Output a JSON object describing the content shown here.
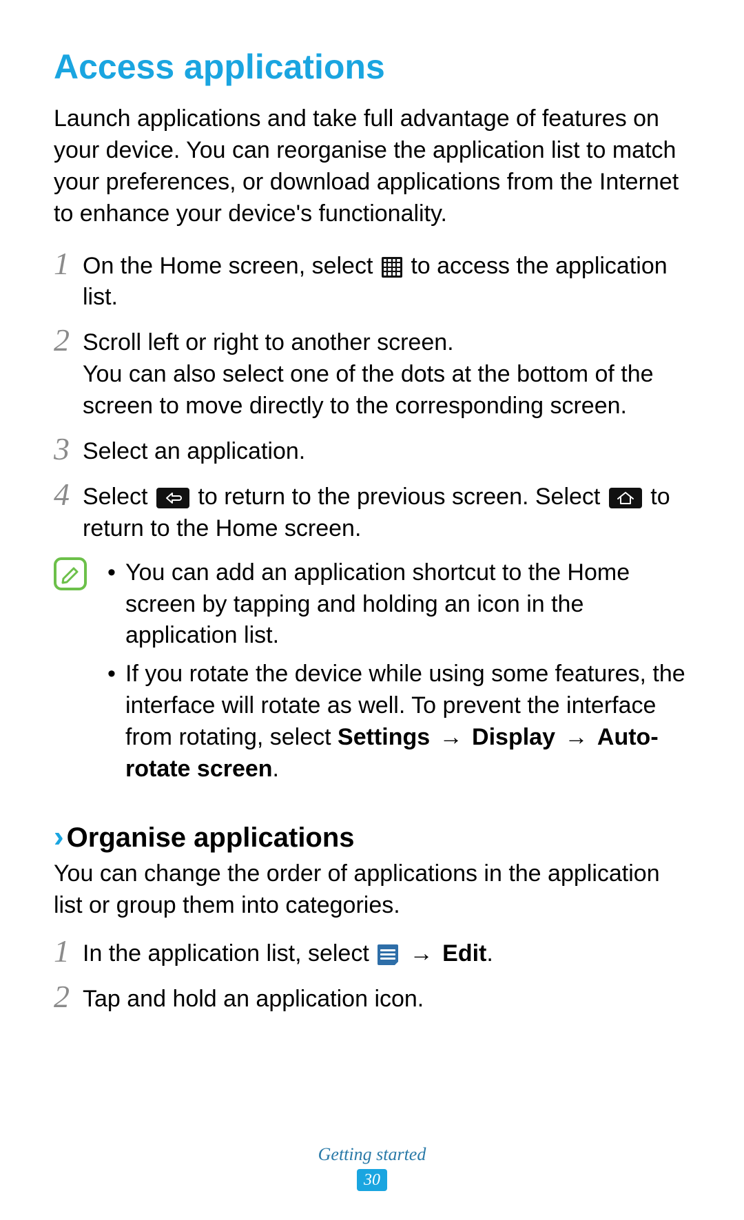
{
  "title": "Access applications",
  "intro": "Launch applications and take full advantage of features on your device. You can reorganise the application list to match your preferences, or download applications from the Internet to enhance your device's functionality.",
  "steps": {
    "s1": {
      "num": "1",
      "pre": "On the Home screen, select ",
      "post": " to access the application list."
    },
    "s2": {
      "num": "2",
      "line1": "Scroll left or right to another screen.",
      "line2": "You can also select one of the dots at the bottom of the screen to move directly to the corresponding screen."
    },
    "s3": {
      "num": "3",
      "text": "Select an application."
    },
    "s4": {
      "num": "4",
      "t1": "Select ",
      "t2": " to return to the previous screen. Select ",
      "t3": " to return to the Home screen."
    }
  },
  "notes": {
    "n1": "You can add an application shortcut to the Home screen by tapping and holding an icon in the application list.",
    "n2": {
      "pre": "If you rotate the device while using some features, the interface will rotate as well. To prevent the interface from rotating, select ",
      "b1": "Settings",
      "arr": " → ",
      "b2": "Display",
      "b3": "Auto-rotate screen",
      "period": "."
    }
  },
  "subheading": {
    "chev": "›",
    "text": "Organise applications"
  },
  "subintro": "You can change the order of applications in the application list or group them into categories.",
  "orgsteps": {
    "s1": {
      "num": "1",
      "pre": "In the application list, select ",
      "arr": " → ",
      "edit": "Edit",
      "period": "."
    },
    "s2": {
      "num": "2",
      "text": "Tap and hold an application icon."
    }
  },
  "footer": {
    "section": "Getting started",
    "page": "30"
  }
}
